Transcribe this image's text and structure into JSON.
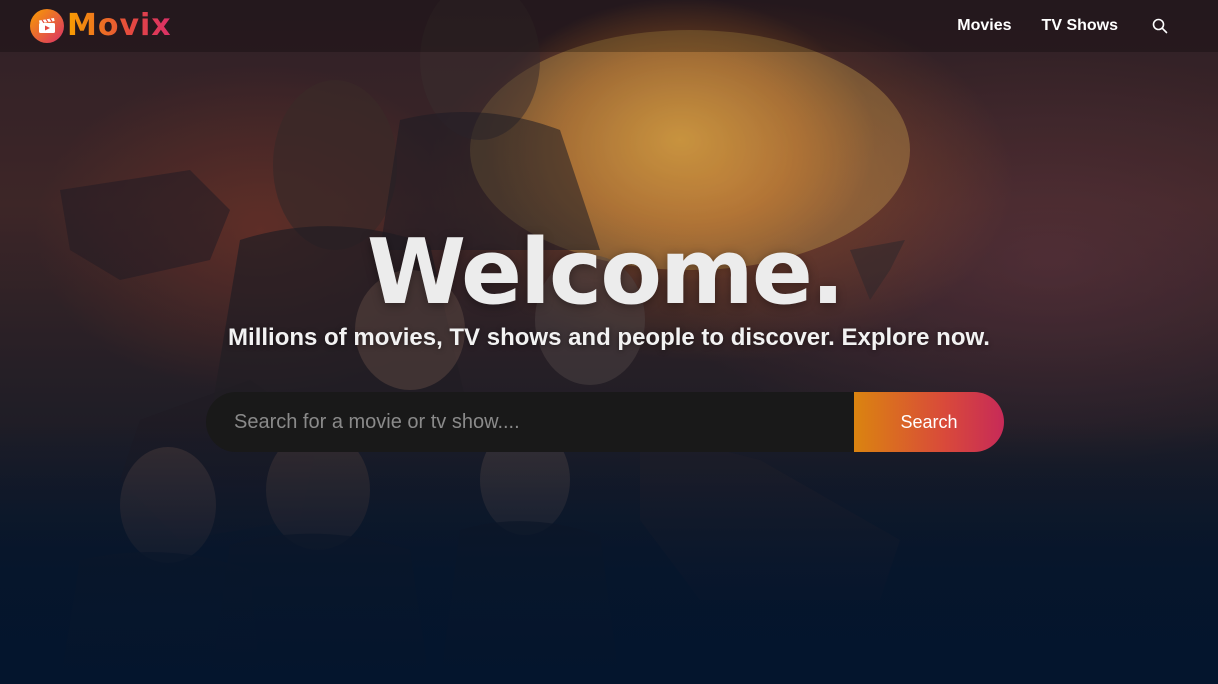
{
  "brand": {
    "name": "Movix",
    "logo_icon": "film-clapper-icon",
    "colors": {
      "gradient_start": "#f89e00",
      "gradient_end": "#da2f68",
      "background": "#04152d"
    }
  },
  "header": {
    "nav": [
      {
        "label": "Movies"
      },
      {
        "label": "TV Shows"
      }
    ],
    "search_icon": "search-icon"
  },
  "hero": {
    "title": "Welcome.",
    "subtitle": "Millions of movies, TV shows and people to discover. Explore now.",
    "search": {
      "placeholder": "Search for a movie or tv show....",
      "value": "",
      "button_label": "Search"
    }
  }
}
